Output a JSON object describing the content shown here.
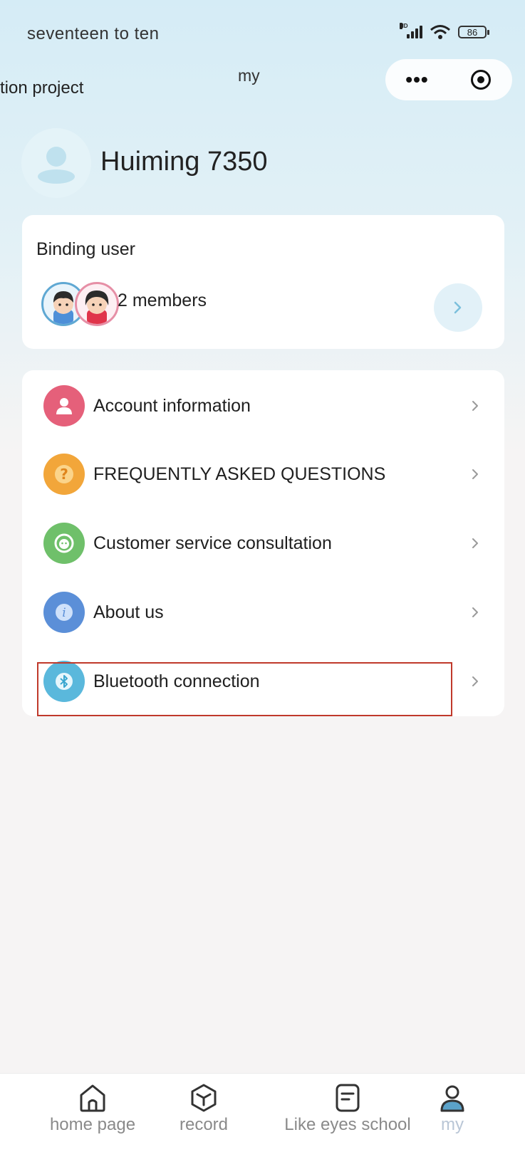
{
  "status_bar": {
    "time": "seventeen to ten",
    "battery": "86"
  },
  "nav": {
    "left_text": "tion project",
    "title": "my"
  },
  "profile": {
    "username": "Huiming 7350"
  },
  "binding": {
    "label": "Binding user",
    "members": "2 members"
  },
  "menu": {
    "items": [
      {
        "label": "Account information",
        "icon": "person-icon",
        "color": "#e5607a"
      },
      {
        "label": "FREQUENTLY ASKED QUESTIONS",
        "icon": "question-icon",
        "color": "#f2a63a"
      },
      {
        "label": "Customer service consultation",
        "icon": "headset-icon",
        "color": "#6fc06a"
      },
      {
        "label": "About us",
        "icon": "info-icon",
        "color": "#5b8fd8"
      },
      {
        "label": "Bluetooth connection",
        "icon": "bluetooth-icon",
        "color": "#5ab8dc"
      }
    ]
  },
  "tabbar": {
    "tabs": [
      {
        "label": "home page",
        "icon": "home-icon"
      },
      {
        "label": "record",
        "icon": "cube-icon"
      },
      {
        "label": "Like eyes school",
        "icon": "note-icon"
      },
      {
        "label": "my",
        "icon": "user-icon",
        "active": true
      }
    ]
  },
  "colors": {
    "accent_highlight": "#c0392b",
    "header_gradient": "#d5ecf6",
    "active_tab": "#b9c6d6"
  }
}
